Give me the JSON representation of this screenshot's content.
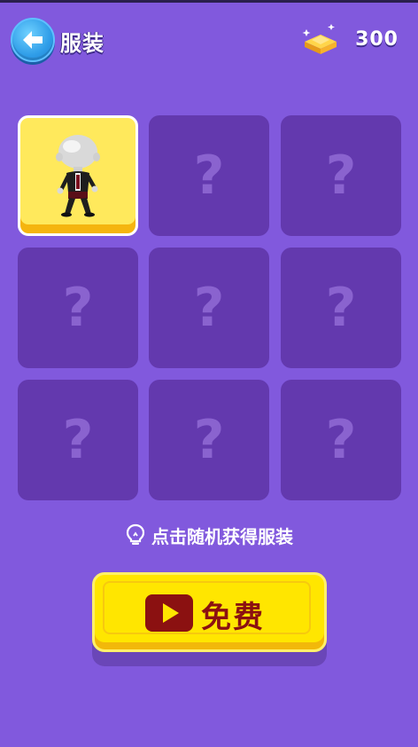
{
  "header": {
    "title": "服装",
    "back_icon": "arrow-left-icon",
    "currency": {
      "icon": "gold-bar-icon",
      "amount": "300"
    }
  },
  "grid": {
    "cells": [
      {
        "state": "unlocked",
        "icon": "character-outfit-icon"
      },
      {
        "state": "locked",
        "label": "?"
      },
      {
        "state": "locked",
        "label": "?"
      },
      {
        "state": "locked",
        "label": "?"
      },
      {
        "state": "locked",
        "label": "?"
      },
      {
        "state": "locked",
        "label": "?"
      },
      {
        "state": "locked",
        "label": "?"
      },
      {
        "state": "locked",
        "label": "?"
      },
      {
        "state": "locked",
        "label": "?"
      }
    ]
  },
  "hint": {
    "icon": "lightbulb-icon",
    "text": "点击随机获得服装"
  },
  "free_button": {
    "icon": "video-play-icon",
    "label": "免费"
  },
  "colors": {
    "background": "#8159DD",
    "locked_cell": "#6339AE",
    "unlocked_cell": "#FFE95C",
    "button_yellow": "#FFE600",
    "button_text": "#8B1111"
  }
}
